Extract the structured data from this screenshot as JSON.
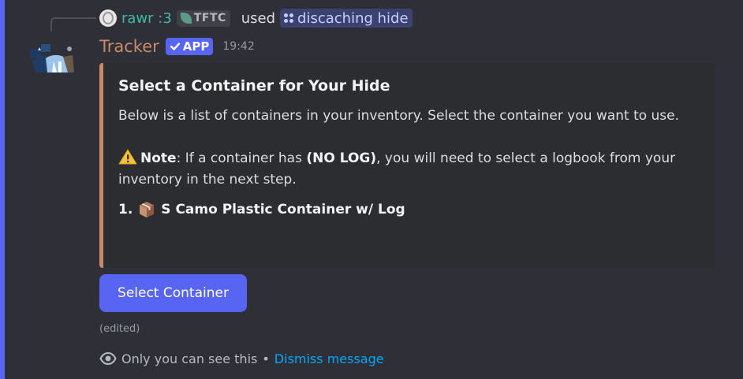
{
  "reply": {
    "username": "rawr :3",
    "tag": "TFTC",
    "used_text": "used",
    "command": "discaching hide"
  },
  "message": {
    "author": "Tracker",
    "badge": "APP",
    "timestamp": "19:42",
    "author_color": "#c98a6b"
  },
  "embed": {
    "title": "Select a Container for Your Hide",
    "intro": "Below is a list of containers in your inventory. Select the container you want to use.",
    "note_label": "Note",
    "note_text_before": ": If a container has ",
    "note_bold": "(NO LOG)",
    "note_text_after": ", you will need to select a logbook from your inventory in the next step.",
    "item_number": "1.",
    "item_name": "S Camo Plastic Container w/ Log",
    "accent_color": "#c98a6b"
  },
  "actions": {
    "select_label": "Select Container"
  },
  "edited_label": "(edited)",
  "footer": {
    "notice": "Only you can see this",
    "separator": "•",
    "dismiss_label": "Dismiss message"
  },
  "icons": {
    "reply_avatar": "user-avatar-icon",
    "tag": "leaf-icon",
    "command": "slash-command-icon",
    "badge": "check-icon",
    "warning": "warning-icon",
    "item": "package-icon",
    "footer": "eye-icon"
  },
  "colors": {
    "brand": "#5865f2",
    "link": "#00a8fc",
    "reply_name": "#3fb8a8"
  }
}
